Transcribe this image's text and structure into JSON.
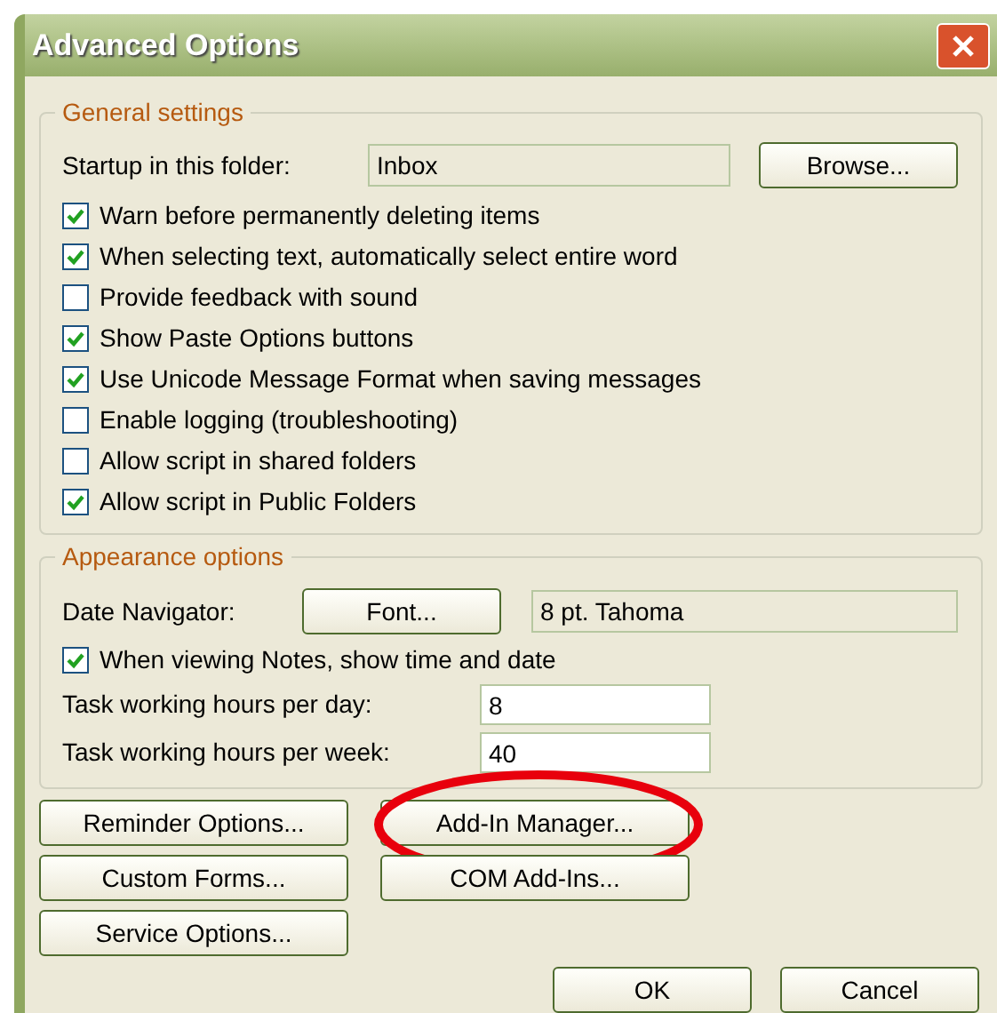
{
  "window": {
    "title": "Advanced Options"
  },
  "general": {
    "title": "General settings",
    "startup_label": "Startup in this folder:",
    "startup_value": "Inbox",
    "browse_button": "Browse...",
    "checkboxes": [
      {
        "label": "Warn before permanently deleting items",
        "checked": true
      },
      {
        "label": "When selecting text, automatically select entire word",
        "checked": true
      },
      {
        "label": "Provide feedback with sound",
        "checked": false
      },
      {
        "label": "Show Paste Options buttons",
        "checked": true
      },
      {
        "label": "Use Unicode Message Format when saving messages",
        "checked": true
      },
      {
        "label": "Enable logging (troubleshooting)",
        "checked": false
      },
      {
        "label": "Allow script in shared folders",
        "checked": false
      },
      {
        "label": "Allow script in Public Folders",
        "checked": true
      }
    ]
  },
  "appearance": {
    "title": "Appearance options",
    "date_navigator_label": "Date Navigator:",
    "font_button": "Font...",
    "font_value": "8 pt. Tahoma",
    "notes_checkbox": {
      "label": "When viewing Notes, show time and date",
      "checked": true
    },
    "fields": [
      {
        "label": "Task working hours per day:",
        "value": "8"
      },
      {
        "label": "Task working hours per week:",
        "value": "40"
      }
    ]
  },
  "buttons": [
    {
      "label": "Reminder Options...",
      "highlighted": false
    },
    {
      "label": "Add-In Manager...",
      "highlighted": true
    },
    {
      "label": "Custom Forms...",
      "highlighted": false
    },
    {
      "label": "COM Add-Ins...",
      "highlighted": false
    },
    {
      "label": "Service Options...",
      "highlighted": false
    }
  ],
  "dialog_buttons": [
    "OK",
    "Cancel"
  ]
}
